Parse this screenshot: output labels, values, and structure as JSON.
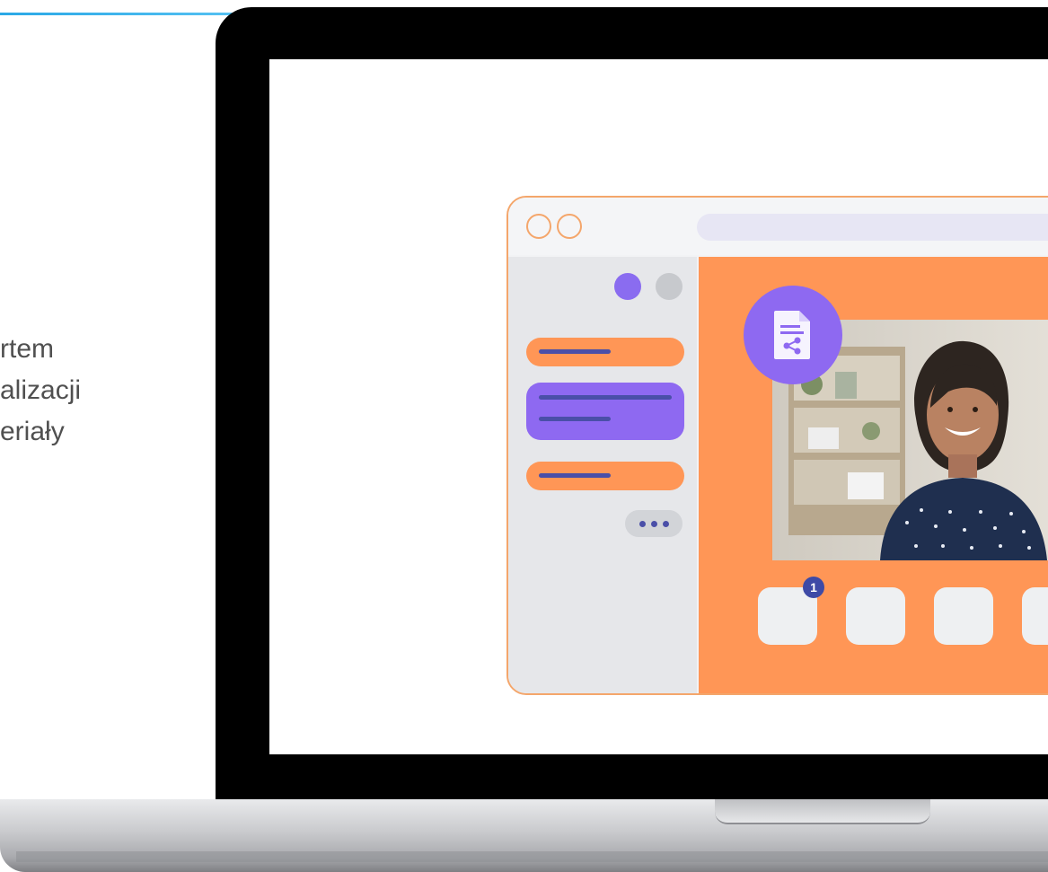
{
  "page_text": {
    "lines": [
      "rtem",
      "alizacji",
      "eriały"
    ]
  },
  "icons": {
    "document_badge": "shared-document-icon",
    "more_menu": "more-dots-icon"
  },
  "notification": {
    "count": "1"
  },
  "colors": {
    "accent_line": "#2aa8e6",
    "app_border": "#f4a66b",
    "main_orange": "#ff9656",
    "purple": "#8e69f1",
    "navy": "#4a4fa8"
  }
}
